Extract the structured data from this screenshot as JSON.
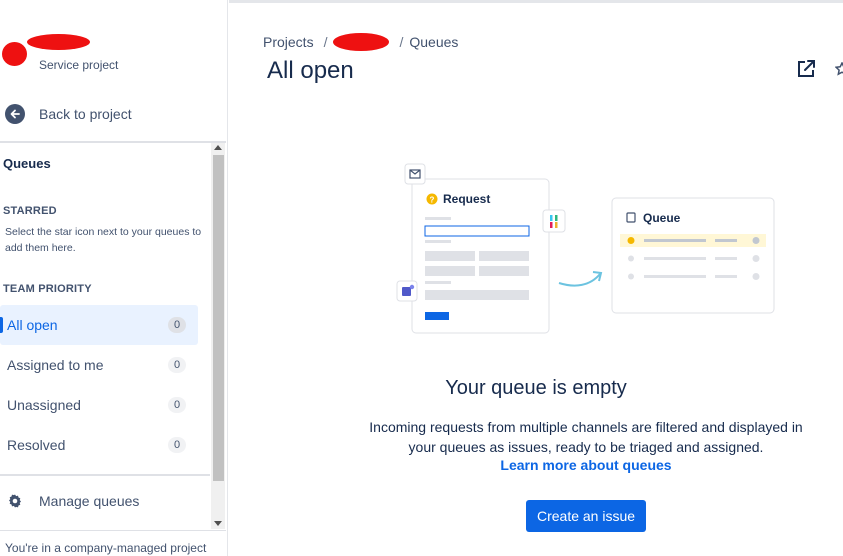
{
  "sidebar": {
    "project_type": "Service project",
    "back_label": "Back to project",
    "queues_title": "Queues",
    "starred_heading": "STARRED",
    "starred_hint": "Select the star icon next to your queues to add them here.",
    "team_priority_heading": "TEAM PRIORITY",
    "items": [
      {
        "label": "All open",
        "count": "0",
        "active": true
      },
      {
        "label": "Assigned to me",
        "count": "0"
      },
      {
        "label": "Unassigned",
        "count": "0"
      },
      {
        "label": "Resolved",
        "count": "0"
      }
    ],
    "manage_label": "Manage queues",
    "company_note": "You're in a company-managed project"
  },
  "header": {
    "breadcrumb_projects": "Projects",
    "breadcrumb_sep": "/",
    "breadcrumb_queues": "Queues",
    "title": "All open"
  },
  "illustration": {
    "request_label": "Request",
    "queue_label": "Queue"
  },
  "empty_state": {
    "title": "Your queue is empty",
    "description": "Incoming requests from multiple channels are filtered and displayed in your queues as issues, ready to be triaged and assigned.",
    "link": "Learn more about queues",
    "button": "Create an issue"
  },
  "colors": {
    "accent": "#0c66e4",
    "active_bg": "#e9f2ff",
    "redaction": "#ee1111"
  },
  "icons": [
    "back-arrow-icon",
    "gear-icon",
    "external-link-icon",
    "star-icon",
    "mail-icon",
    "slack-icon",
    "teams-icon",
    "queue-icon",
    "warning-icon"
  ]
}
